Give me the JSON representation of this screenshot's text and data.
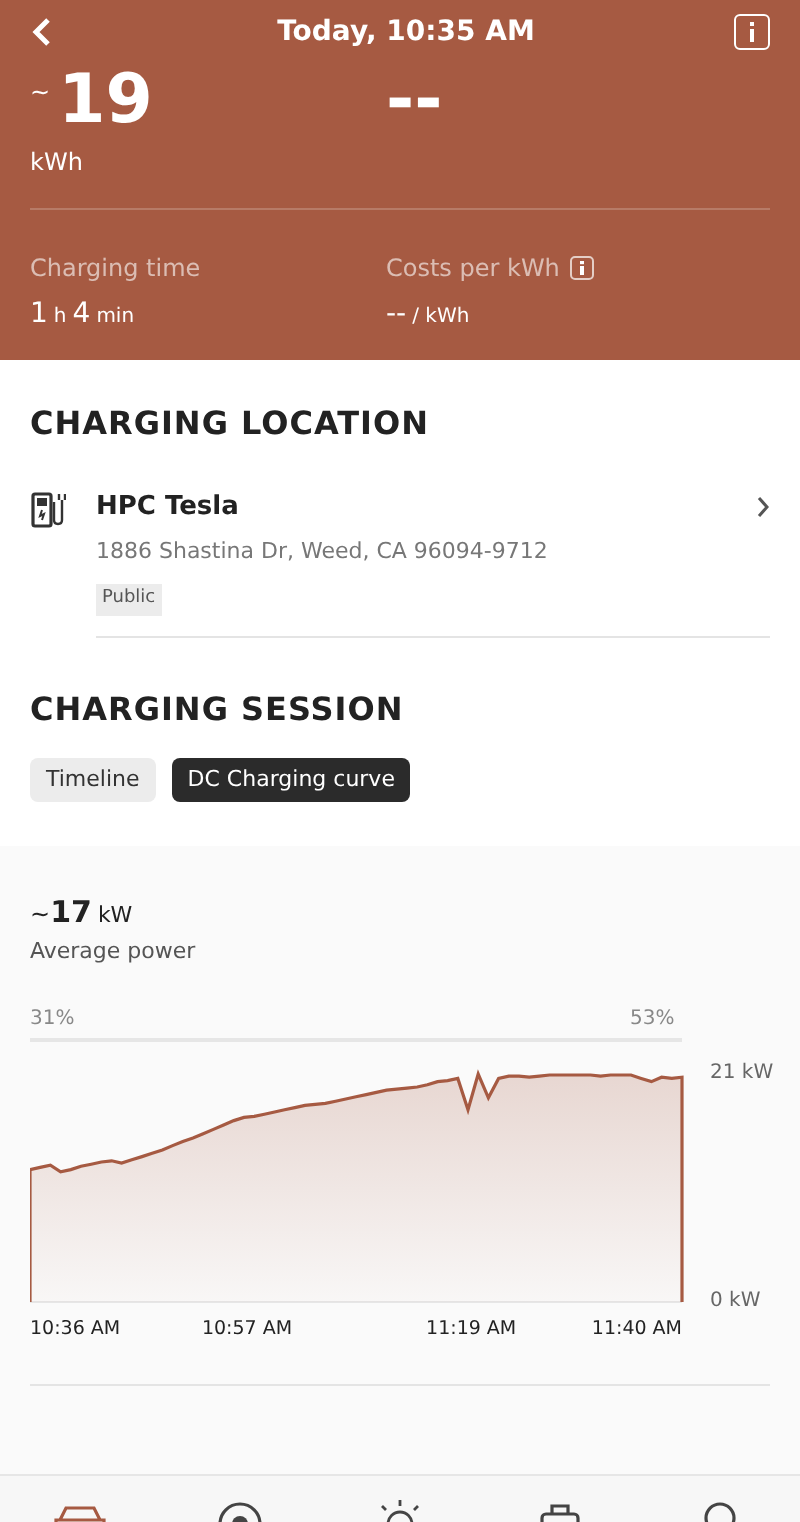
{
  "header": {
    "title": "Today, 10:35 AM",
    "energy": {
      "prefix": "~",
      "value": "19",
      "unit": "kWh"
    },
    "cost": {
      "value": "--"
    }
  },
  "stats": [
    {
      "label": "Charging time",
      "info": false,
      "parts": [
        {
          "kind": "number",
          "text": "1"
        },
        {
          "kind": "unit",
          "text": "h"
        },
        {
          "kind": "number",
          "text": "4"
        },
        {
          "kind": "unit",
          "text": "min"
        }
      ]
    },
    {
      "label": "Costs per kWh",
      "info": true,
      "parts": [
        {
          "kind": "number",
          "text": "--"
        },
        {
          "kind": "unit",
          "text": "/ kWh"
        }
      ]
    }
  ],
  "location": {
    "heading": "CHARGING LOCATION",
    "name": "HPC Tesla",
    "address": "1886 Shastina Dr, Weed, CA 96094-9712",
    "tag": "Public"
  },
  "session": {
    "heading": "CHARGING SESSION",
    "tabs": [
      {
        "label": "Timeline",
        "selected": false
      },
      {
        "label": "DC Charging curve",
        "selected": true
      }
    ],
    "average": {
      "prefix": "~",
      "value": "17",
      "unit": "kW",
      "label": "Average power"
    },
    "soc_start": "31%",
    "soc_end": "53%",
    "chart_data": {
      "type": "area",
      "categories": [
        "10:36 AM",
        null,
        null,
        null,
        null,
        null,
        null,
        null,
        null,
        null,
        null,
        null,
        null,
        null,
        null,
        null,
        null,
        null,
        null,
        null,
        null,
        "10:57 AM",
        null,
        null,
        null,
        null,
        null,
        null,
        null,
        null,
        null,
        null,
        null,
        null,
        null,
        null,
        null,
        null,
        null,
        null,
        null,
        null,
        null,
        "11:19 AM",
        null,
        null,
        null,
        null,
        null,
        null,
        null,
        null,
        null,
        null,
        null,
        null,
        null,
        null,
        null,
        null,
        null,
        null,
        null,
        null,
        "11:40 AM"
      ],
      "series": [
        {
          "color": "#a65a42",
          "values": [
            12.2,
            12.4,
            12.6,
            12.0,
            12.2,
            12.5,
            12.7,
            12.9,
            13.0,
            12.8,
            13.1,
            13.4,
            13.7,
            14.0,
            14.4,
            14.8,
            15.1,
            15.5,
            15.9,
            16.3,
            16.7,
            17.0,
            17.1,
            17.3,
            17.5,
            17.7,
            17.9,
            18.1,
            18.2,
            18.3,
            18.5,
            18.7,
            18.9,
            19.1,
            19.3,
            19.5,
            19.6,
            19.7,
            19.8,
            20.0,
            20.3,
            20.4,
            20.6,
            17.7,
            21.0,
            18.8,
            20.6,
            20.8,
            20.8,
            20.7,
            20.8,
            20.9,
            20.9,
            20.9,
            20.9,
            20.9,
            20.8,
            20.9,
            20.9,
            20.9,
            20.6,
            20.3,
            20.7,
            20.6,
            20.7
          ]
        }
      ],
      "ylim": [
        0,
        21
      ],
      "yticks": [
        {
          "value": 0,
          "label": "0 kW"
        },
        {
          "value": 21,
          "label": "21 kW"
        }
      ]
    }
  },
  "nav": [
    {
      "kind": "car",
      "selected": true
    },
    {
      "kind": "target",
      "selected": false
    },
    {
      "kind": "sun",
      "selected": false
    },
    {
      "kind": "case",
      "selected": false
    },
    {
      "kind": "person",
      "selected": false
    }
  ]
}
